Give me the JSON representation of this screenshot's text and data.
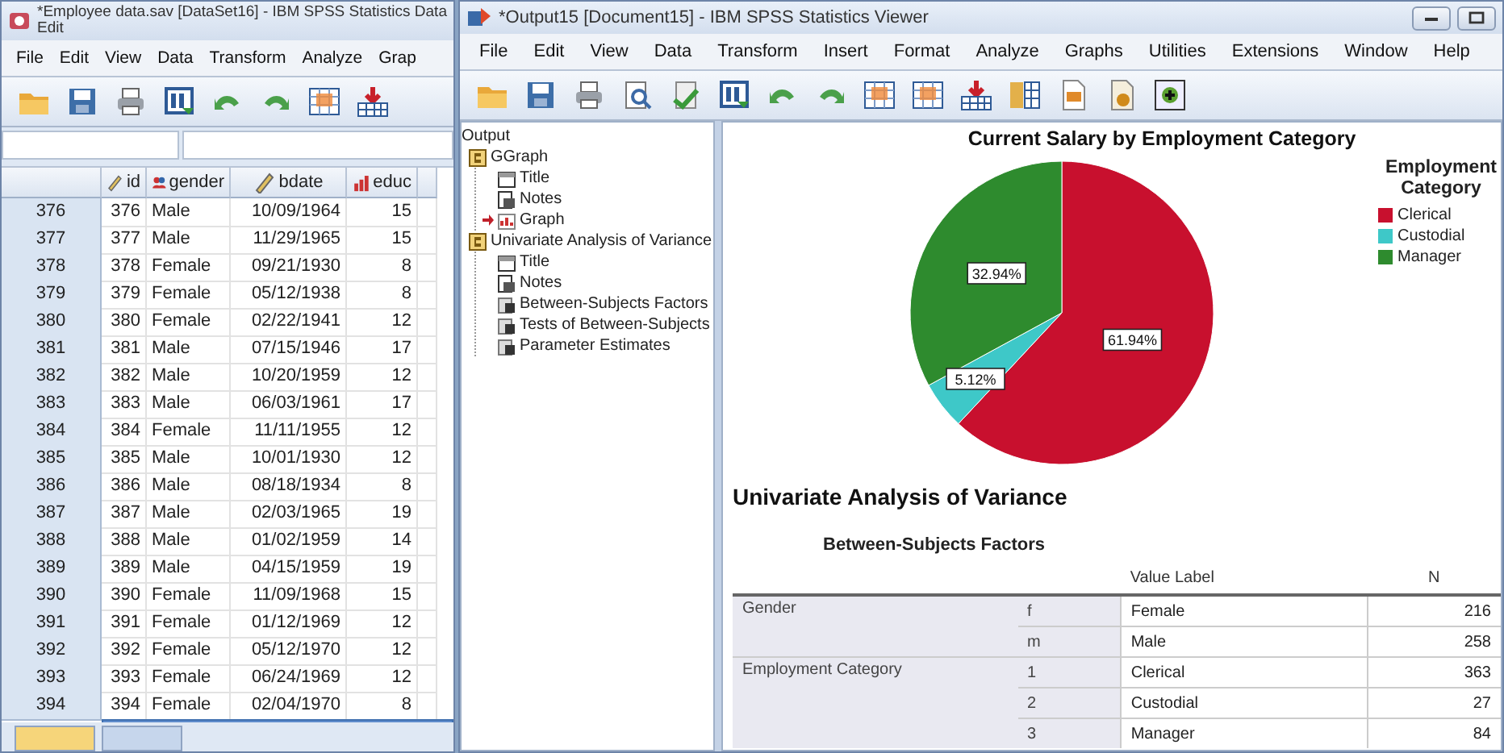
{
  "data_editor": {
    "title": "*Employee data.sav [DataSet16] - IBM SPSS Statistics Data Edit",
    "menu": [
      "File",
      "Edit",
      "View",
      "Data",
      "Transform",
      "Analyze",
      "Grap"
    ],
    "columns": [
      {
        "name": "id",
        "kind": "scale"
      },
      {
        "name": "gender",
        "kind": "nominal"
      },
      {
        "name": "bdate",
        "kind": "scale"
      },
      {
        "name": "educ",
        "kind": "ordinal"
      }
    ],
    "rows": [
      {
        "case": "376",
        "id": "376",
        "gender": "Male",
        "bdate": "10/09/1964",
        "educ": "15"
      },
      {
        "case": "377",
        "id": "377",
        "gender": "Male",
        "bdate": "11/29/1965",
        "educ": "15"
      },
      {
        "case": "378",
        "id": "378",
        "gender": "Female",
        "bdate": "09/21/1930",
        "educ": "8"
      },
      {
        "case": "379",
        "id": "379",
        "gender": "Female",
        "bdate": "05/12/1938",
        "educ": "8"
      },
      {
        "case": "380",
        "id": "380",
        "gender": "Female",
        "bdate": "02/22/1941",
        "educ": "12"
      },
      {
        "case": "381",
        "id": "381",
        "gender": "Male",
        "bdate": "07/15/1946",
        "educ": "17"
      },
      {
        "case": "382",
        "id": "382",
        "gender": "Male",
        "bdate": "10/20/1959",
        "educ": "12"
      },
      {
        "case": "383",
        "id": "383",
        "gender": "Male",
        "bdate": "06/03/1961",
        "educ": "17"
      },
      {
        "case": "384",
        "id": "384",
        "gender": "Female",
        "bdate": "11/11/1955",
        "educ": "12"
      },
      {
        "case": "385",
        "id": "385",
        "gender": "Male",
        "bdate": "10/01/1930",
        "educ": "12"
      },
      {
        "case": "386",
        "id": "386",
        "gender": "Male",
        "bdate": "08/18/1934",
        "educ": "8"
      },
      {
        "case": "387",
        "id": "387",
        "gender": "Male",
        "bdate": "02/03/1965",
        "educ": "19"
      },
      {
        "case": "388",
        "id": "388",
        "gender": "Male",
        "bdate": "01/02/1959",
        "educ": "14"
      },
      {
        "case": "389",
        "id": "389",
        "gender": "Male",
        "bdate": "04/15/1959",
        "educ": "19"
      },
      {
        "case": "390",
        "id": "390",
        "gender": "Female",
        "bdate": "11/09/1968",
        "educ": "15"
      },
      {
        "case": "391",
        "id": "391",
        "gender": "Female",
        "bdate": "01/12/1969",
        "educ": "12"
      },
      {
        "case": "392",
        "id": "392",
        "gender": "Female",
        "bdate": "05/12/1970",
        "educ": "12"
      },
      {
        "case": "393",
        "id": "393",
        "gender": "Female",
        "bdate": "06/24/1969",
        "educ": "12"
      },
      {
        "case": "394",
        "id": "394",
        "gender": "Female",
        "bdate": "02/04/1970",
        "educ": "8"
      }
    ]
  },
  "viewer": {
    "title": "*Output15 [Document15] - IBM SPSS Statistics Viewer",
    "menu": [
      "File",
      "Edit",
      "View",
      "Data",
      "Transform",
      "Insert",
      "Format",
      "Analyze",
      "Graphs",
      "Utilities",
      "Extensions",
      "Window",
      "Help"
    ],
    "outline": {
      "root": "Output",
      "items": [
        {
          "label": "GGraph",
          "kind": "book",
          "current": false,
          "children": [
            {
              "label": "Title",
              "kind": "title",
              "current": false
            },
            {
              "label": "Notes",
              "kind": "notes",
              "current": false
            },
            {
              "label": "Graph",
              "kind": "chart",
              "current": true
            }
          ]
        },
        {
          "label": "Univariate Analysis of Variance",
          "kind": "book",
          "current": false,
          "children": [
            {
              "label": "Title",
              "kind": "title",
              "current": false
            },
            {
              "label": "Notes",
              "kind": "notes",
              "current": false
            },
            {
              "label": "Between-Subjects Factors",
              "kind": "table",
              "current": false
            },
            {
              "label": "Tests of Between-Subjects",
              "kind": "table",
              "current": false
            },
            {
              "label": "Parameter Estimates",
              "kind": "table",
              "current": false
            }
          ]
        }
      ]
    },
    "chart_data": {
      "type": "pie",
      "title": "Current Salary by Employment Category",
      "categories": [
        "Clerical",
        "Custodial",
        "Manager"
      ],
      "values": [
        61.94,
        5.12,
        32.94
      ],
      "colors": [
        "#c8102e",
        "#3ec8c8",
        "#2e8b2e"
      ],
      "legend": "right",
      "legend_title": "Employment Category",
      "value_labels": [
        "61.94%",
        "5.12%",
        "32.94%"
      ]
    },
    "heading": "Univariate Analysis of Variance",
    "table": {
      "title": "Between-Subjects Factors",
      "columns": [
        "Value Label",
        "N"
      ],
      "groups": [
        {
          "label": "Gender",
          "rows": [
            {
              "code": "f",
              "value_label": "Female",
              "n": "216"
            },
            {
              "code": "m",
              "value_label": "Male",
              "n": "258"
            }
          ]
        },
        {
          "label": "Employment Category",
          "rows": [
            {
              "code": "1",
              "value_label": "Clerical",
              "n": "363"
            },
            {
              "code": "2",
              "value_label": "Custodial",
              "n": "27"
            },
            {
              "code": "3",
              "value_label": "Manager",
              "n": "84"
            }
          ]
        }
      ]
    }
  }
}
